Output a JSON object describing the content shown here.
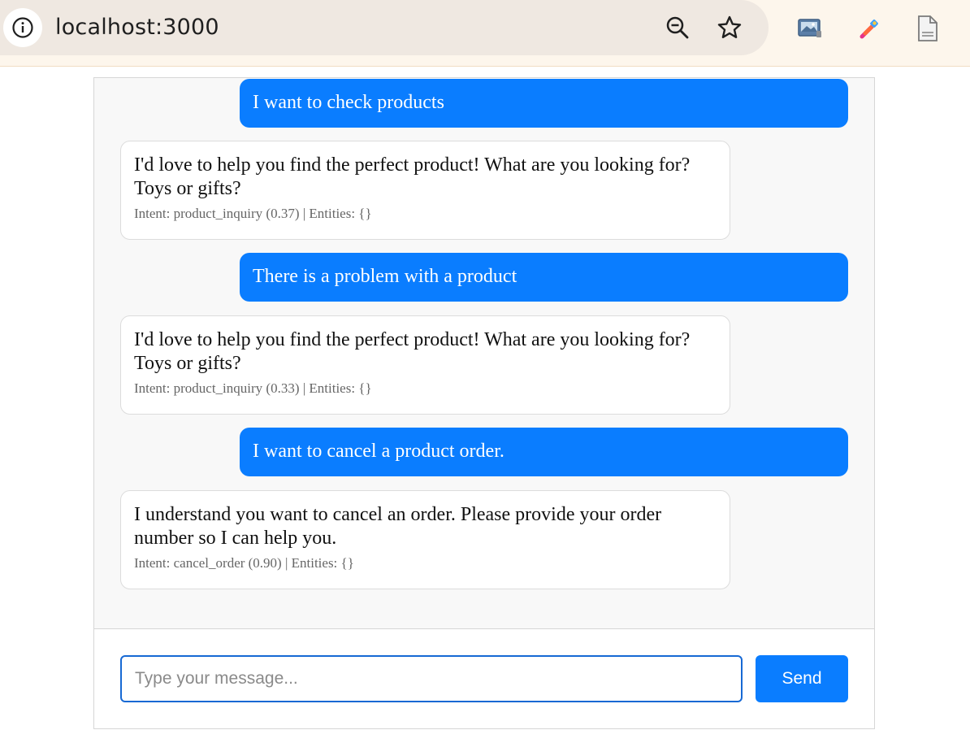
{
  "browser": {
    "url": "localhost:3000",
    "icons": {
      "site_info": "info-icon",
      "zoom": "zoom-out-icon",
      "bookmark": "star-icon",
      "ext_1": "image-extension-icon",
      "ext_2": "color-picker-icon",
      "ext_3": "document-icon"
    }
  },
  "chat": {
    "messages": [
      {
        "role": "user",
        "text": "I want to check products"
      },
      {
        "role": "bot",
        "text": "I'd love to help you find the perfect product! What are you looking for? Toys or gifts?",
        "meta": "Intent: product_inquiry (0.37) | Entities: {}"
      },
      {
        "role": "user",
        "text": "There is a problem with a product"
      },
      {
        "role": "bot",
        "text": "I'd love to help you find the perfect product! What are you looking for? Toys or gifts?",
        "meta": "Intent: product_inquiry (0.33) | Entities: {}"
      },
      {
        "role": "user",
        "text": "I want to cancel a product order."
      },
      {
        "role": "bot",
        "text": "I understand you want to cancel an order. Please provide your order number so I can help you.",
        "meta": "Intent: cancel_order (0.90) | Entities: {}"
      }
    ],
    "input": {
      "value": "",
      "placeholder": "Type your message..."
    },
    "send_label": "Send"
  },
  "colors": {
    "accent": "#0a7dff",
    "input_border": "#1769d4",
    "message_area_bg": "#f8f8f8",
    "toolbar_bg": "#fdf6ec"
  }
}
